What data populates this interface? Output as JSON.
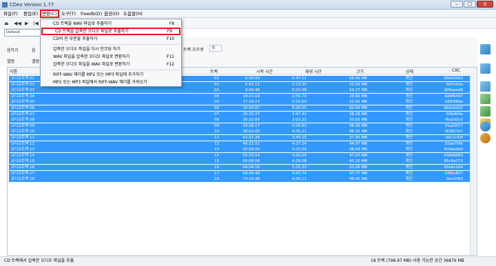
{
  "window": {
    "title": "CDex Version 1.77",
    "min": "–",
    "max": "□",
    "close": "X"
  },
  "menu": [
    "파일(F)",
    "편집(E)",
    "변환(C)",
    "도구(T)",
    "freedb(D)",
    "옵션(O)",
    "도움말(H)"
  ],
  "drive": "Default",
  "info": {
    "artist_label": "음악가",
    "artist_value": "음",
    "album_label": "앨범",
    "album_value": "앨범",
    "offset_label": "트랙 오프셋",
    "offset_value": "0"
  },
  "dropdown": [
    {
      "label": "CD 트랙을 WAV 파일로 추출하기",
      "shortcut": "F8"
    },
    {
      "label": "CD 트랙을 압축한 오디오 파일로 추출하기",
      "shortcut": "F9",
      "highlight": true
    },
    {
      "label": "CD의 한 부분을 추출하기",
      "shortcut": "F10"
    },
    {
      "label": "압축한 오디오 파일을 다시 인코딩 하기",
      "shortcut": ""
    },
    {
      "label": "WAV 파일을 압축한 오디오 파일로 변환하기",
      "shortcut": "F11"
    },
    {
      "label": "압축한 오디오 파일을 WAV 파일로 변환하기",
      "shortcut": "F12"
    },
    {
      "label": "RIFF-WAV 헤더를 MP2 또는 MP3 파일에 추가하기",
      "shortcut": ""
    },
    {
      "label": "MP2 또는 MP3 파일에서 RIFF-WAV 헤더를 가져오기",
      "shortcut": ""
    }
  ],
  "columns": [
    "이름",
    "트랙",
    "시작 시간",
    "재생 시간",
    "크기",
    "상태",
    "CRC"
  ],
  "tracks": [
    [
      "오디오트랙 01",
      "01",
      "0:00.00",
      "5:47.11",
      "58.40 MB",
      "확인",
      "38db30d3"
    ],
    [
      "오디오트랙 02",
      "02",
      "5:47.11",
      "3:13.35",
      "32.54 MB",
      "확인",
      "847e54e"
    ],
    [
      "오디오트랙 03",
      "03",
      "9:00.46",
      "5:22.48",
      "54.27 MB",
      "확인",
      "d06aaa48"
    ],
    [
      "오디오트랙 04",
      "04",
      "14:23.19",
      "2:55.73",
      "29.60 MB",
      "확인",
      "6d4f6497"
    ],
    [
      "오디오트랙 05",
      "05",
      "17:19.17",
      "3:15.50",
      "32.91 MB",
      "확인",
      "d393f8da"
    ],
    [
      "오디오트랙 06",
      "06",
      "20:34.67",
      "6:00.35",
      "60.64 MB",
      "확인",
      "b8dc6d32"
    ],
    [
      "오디오트랙 07",
      "07",
      "26:35.27",
      "3:47.42",
      "38.28 MB",
      "확인",
      "5f4b6f4e"
    ],
    [
      "오디오트랙 08",
      "08",
      "30:22.69",
      "3:03.23",
      "30.83 MB",
      "확인",
      "f6a2d3c0"
    ],
    [
      "오디오트랙 09",
      "09",
      "33:26.17",
      "4:35.63",
      "46.40 MB",
      "확인",
      "41a29f17"
    ],
    [
      "오디오트랙 10",
      "10",
      "38:02.05",
      "4:35.21",
      "46.31 MB",
      "확인",
      "df3827e7"
    ],
    [
      "오디오트랙 11",
      "11",
      "42:37.26",
      "3:45.25",
      "37.90 MB",
      "확인",
      "d9c1c33f"
    ],
    [
      "오디오트랙 12",
      "12",
      "46:22.51",
      "4:27.24",
      "44.97 MB",
      "확인",
      "82de7f96"
    ],
    [
      "오디오트랙 13",
      "13",
      "50:50.00",
      "4:33.54",
      "46.04 MB",
      "확인",
      "8cbbede9"
    ],
    [
      "오디오트랙 14",
      "14",
      "55:23.54",
      "4:42.29",
      "47.50 MB",
      "확인",
      "43889083"
    ],
    [
      "오디오트랙 15",
      "15",
      "60:06.08",
      "4:28.08",
      "45.10 MB",
      "확인",
      "85c6a375"
    ],
    [
      "오디오트랙 16",
      "16",
      "64:34.16",
      "5:15.33",
      "53.06 MB",
      "확인",
      "b5edc1b4"
    ],
    [
      "오디오트랙 17",
      "17",
      "69:49.49",
      "4:43.74",
      "47.77 MB",
      "확인",
      "b5fbc807"
    ],
    [
      "오디오트랙 18",
      "18",
      "74:33.48",
      "4:36.11",
      "46.45 MB",
      "확인",
      "0ecf2f63"
    ]
  ],
  "status": {
    "left": "CD 트랙에서 압축한 오디오 파일을 추출",
    "right": "18 트랙 (798.97 MB) 사용 가능한 공간 36879 MB"
  },
  "colors": {
    "selection": "#3399ff",
    "highlight_border": "#e01818"
  },
  "sidebar_icons": [
    "extract-wav-icon",
    "extract-compressed-icon",
    "convert-icon",
    "playlist-icon",
    "tag-icon",
    "folder-icon",
    "config-icon",
    "exit-icon"
  ]
}
